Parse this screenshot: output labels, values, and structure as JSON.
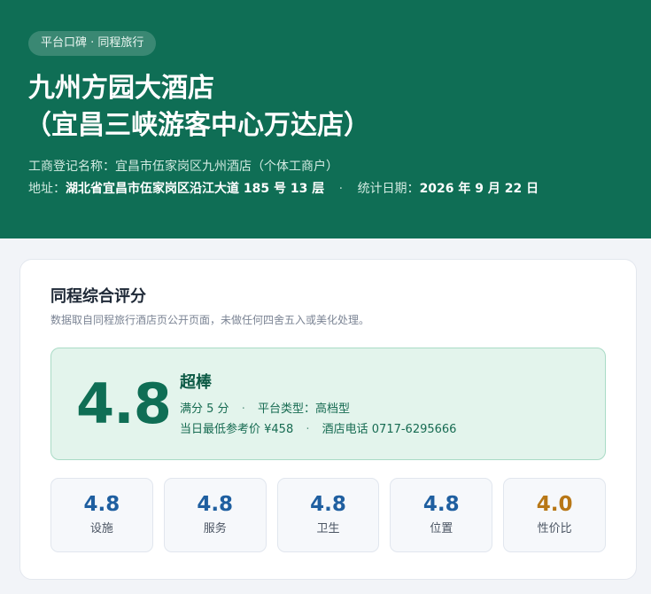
{
  "header": {
    "badge": "平台口碑 · 同程旅行",
    "title_line1": "九州方园大酒店",
    "title_line2": "（宜昌三峡游客中心万达店）",
    "registered_label": "工商登记名称：",
    "registered_value": "宜昌市伍家岗区九州酒店（个体工商户）",
    "address_label": "地址：",
    "address_value": "湖北省宜昌市伍家岗区沿江大道 185 号 13 层",
    "date_label": "统计日期：",
    "date_value": "2026 年 9 月 22 日"
  },
  "card": {
    "title": "同程综合评分",
    "subtitle": "数据取自同程旅行酒店页公开页面，未做任何四舍五入或美化处理。",
    "overall_score": "4.8",
    "rating_word": "超棒",
    "full_score": "满分 5 分",
    "platform_type": "平台类型：高档型",
    "min_price": "当日最低参考价 ¥458",
    "hotel_phone": "酒店电话 0717-6295666",
    "sub_scores": [
      {
        "value": "4.8",
        "label": "设施"
      },
      {
        "value": "4.8",
        "label": "服务"
      },
      {
        "value": "4.8",
        "label": "卫生"
      },
      {
        "value": "4.8",
        "label": "位置"
      },
      {
        "value": "4.0",
        "label": "性价比"
      }
    ]
  },
  "colors": {
    "header_bg": "#0f6e55",
    "score_green": "#0f6e55",
    "sub_score_blue": "#1f5fa0",
    "sub_score_amber": "#b87716"
  }
}
